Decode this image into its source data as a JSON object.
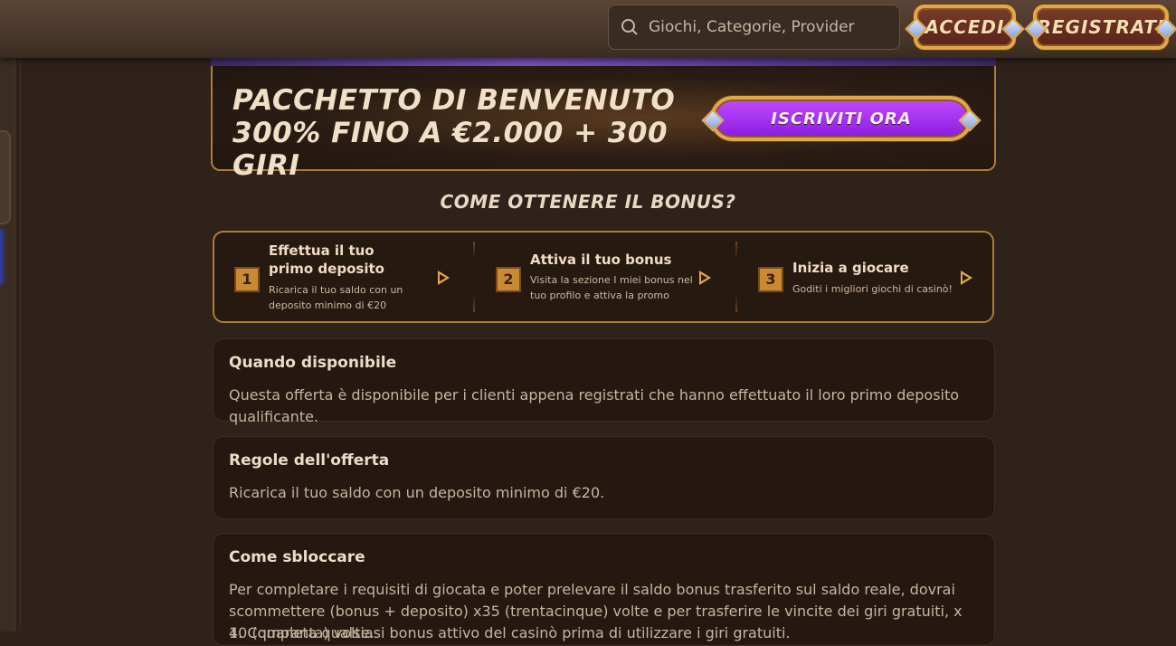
{
  "header": {
    "search_placeholder": "Giochi, Categorie, Provider",
    "login_label": "ACCEDI",
    "register_label": "REGISTRATI"
  },
  "hero": {
    "title": "PACCHETTO DI BENVENUTO 300% FINO A €2.000 + 300 GIRI",
    "join_label": "ISCRIVITI ORA"
  },
  "howto": {
    "title": "COME OTTENERE IL BONUS?",
    "steps": [
      {
        "number": "1",
        "title": "Effettua il tuo primo deposito",
        "desc": "Ricarica il tuo saldo con un deposito minimo di €20"
      },
      {
        "number": "2",
        "title": "Attiva il tuo bonus",
        "desc": "Visita la sezione I miei bonus nel tuo profilo e attiva la promo"
      },
      {
        "number": "3",
        "title": "Inizia a giocare",
        "desc": "Goditi i migliori giochi di casinò!"
      }
    ]
  },
  "sections": [
    {
      "title": "Quando disponibile",
      "text": "Questa offerta è disponibile per i clienti appena registrati che hanno effettuato il loro primo deposito qualificante."
    },
    {
      "title": "Regole dell'offerta",
      "text": "Ricarica il tuo saldo con un deposito minimo di €20."
    },
    {
      "title": "Come sbloccare",
      "text": "Per completare i requisiti di giocata e poter prelevare il saldo bonus trasferito sul saldo reale, dovrai scommettere (bonus + deposito) x35 (trentacinque) volte e per trasferire le vincite dei giri gratuiti, x 40 (quaranta) volte.",
      "list_item": "1. Completa qualsiasi bonus attivo del casinò prima di utilizzare i giri gratuiti."
    }
  ]
}
